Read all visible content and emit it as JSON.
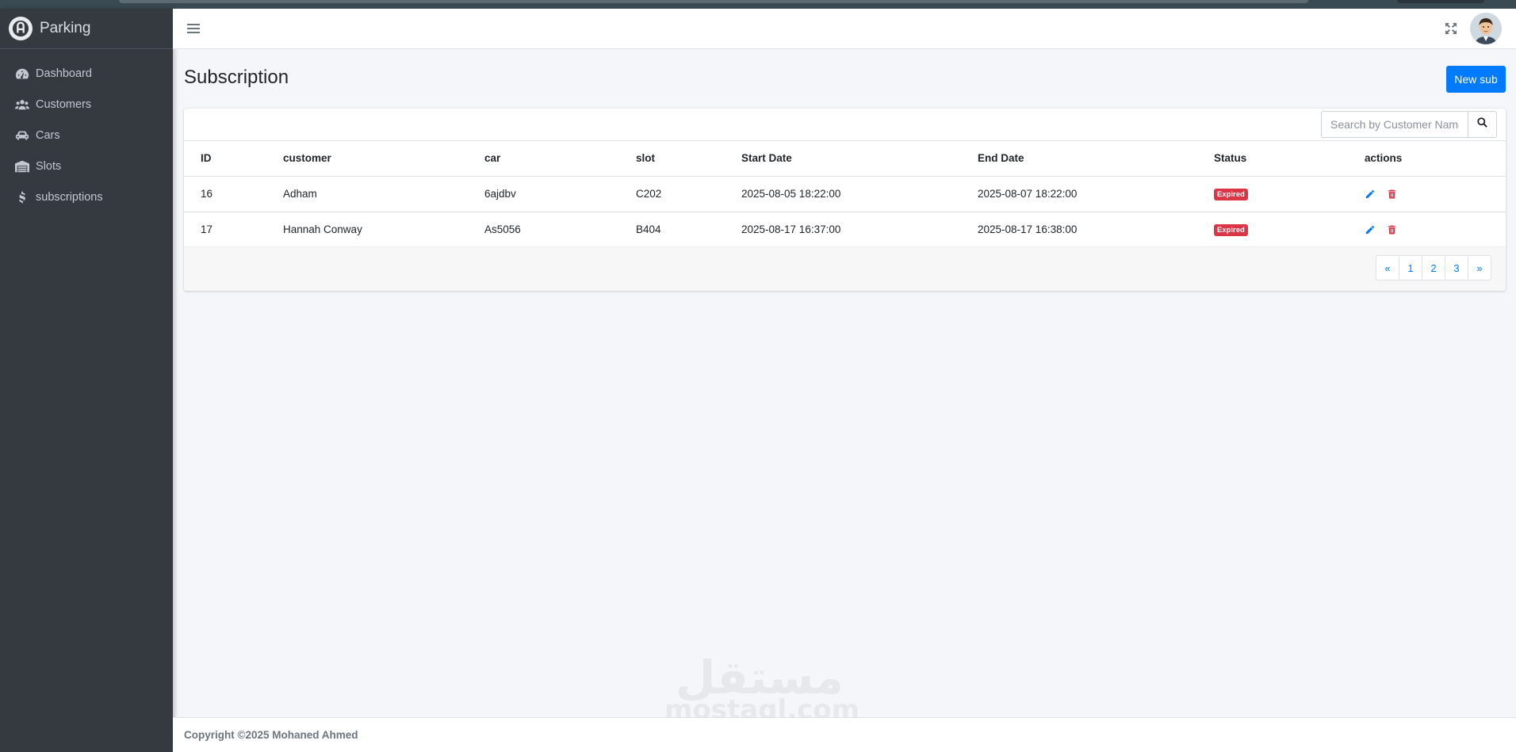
{
  "brand": {
    "name": "Parking",
    "logo_icon": "parking-logo-icon"
  },
  "sidebar": {
    "items": [
      {
        "label": "Dashboard",
        "icon": "gauge-icon"
      },
      {
        "label": "Customers",
        "icon": "users-icon"
      },
      {
        "label": "Cars",
        "icon": "car-icon"
      },
      {
        "label": "Slots",
        "icon": "warehouse-icon"
      },
      {
        "label": "subscriptions",
        "icon": "dollar-icon"
      }
    ]
  },
  "topbar": {
    "menu_icon": "hamburger-icon",
    "fullscreen_icon": "expand-icon",
    "avatar": "user-avatar"
  },
  "page": {
    "title": "Subscription",
    "new_button": "New sub"
  },
  "search": {
    "placeholder": "Search by Customer Name",
    "icon": "search-icon"
  },
  "table": {
    "headers": [
      "ID",
      "customer",
      "car",
      "slot",
      "Start Date",
      "End Date",
      "Status",
      "actions"
    ],
    "rows": [
      {
        "id": "16",
        "customer": "Adham",
        "car": "6ajdbv",
        "slot": "C202",
        "start": "2025-08-05 18:22:00",
        "end": "2025-08-07 18:22:00",
        "status": "Expired"
      },
      {
        "id": "17",
        "customer": "Hannah Conway",
        "car": "As5056",
        "slot": "B404",
        "start": "2025-08-17 16:37:00",
        "end": "2025-08-17 16:38:00",
        "status": "Expired"
      }
    ]
  },
  "pagination": {
    "prev": "«",
    "pages": [
      "1",
      "2",
      "3"
    ],
    "next": "»"
  },
  "footer": {
    "copyright": "Copyright ©2025 Mohaned Ahmed"
  },
  "watermark": {
    "arabic": "مستقل",
    "latin": "mostaql.com"
  },
  "colors": {
    "primary": "#007bff",
    "danger": "#dc3545",
    "sidebar_bg": "#343a40",
    "content_bg": "#f4f6f9"
  }
}
